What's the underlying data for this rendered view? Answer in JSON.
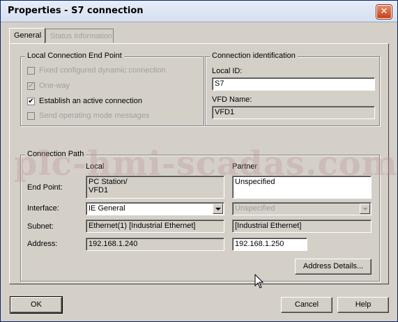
{
  "window": {
    "title": "Properties - S7 connection",
    "close_glyph": "✕"
  },
  "tabs": [
    {
      "label": "General"
    },
    {
      "label": "Status Information"
    }
  ],
  "local_endpoint": {
    "legend": "Local Connection End Point",
    "options": [
      {
        "label": "Fixed configured dynamic connection",
        "checked": false,
        "enabled": false
      },
      {
        "label": "One-way",
        "checked": true,
        "enabled": false
      },
      {
        "label": "Establish an active connection",
        "checked": true,
        "enabled": true
      },
      {
        "label": "Send operating mode messages",
        "checked": false,
        "enabled": false
      }
    ]
  },
  "connection_id": {
    "legend": "Connection identification",
    "local_id_label": "Local ID:",
    "local_id_value": "S7",
    "vfd_label": "VFD Name:",
    "vfd_value": "VFD1"
  },
  "connection_path": {
    "legend": "Connection Path",
    "col_local": "Local",
    "col_partner": "Partner",
    "rows": {
      "end_point_label": "End Point:",
      "end_point_local_1": "PC Station/",
      "end_point_local_2": "VFD1",
      "end_point_partner": "Unspecified",
      "interface_label": "Interface:",
      "interface_local": "IE General",
      "interface_partner": "Unspecified",
      "subnet_label": "Subnet:",
      "subnet_local": "Ethernet(1) [Industrial Ethernet]",
      "subnet_partner": "[Industrial Ethernet]",
      "address_label": "Address:",
      "address_local": "192.168.1.240",
      "address_partner": "192.168.1.250"
    },
    "address_details_button": "Address Details..."
  },
  "footer": {
    "ok": "OK",
    "cancel": "Cancel",
    "help": "Help"
  },
  "watermark": "plc-hmi-scadas.com",
  "check_glyph": "✔"
}
